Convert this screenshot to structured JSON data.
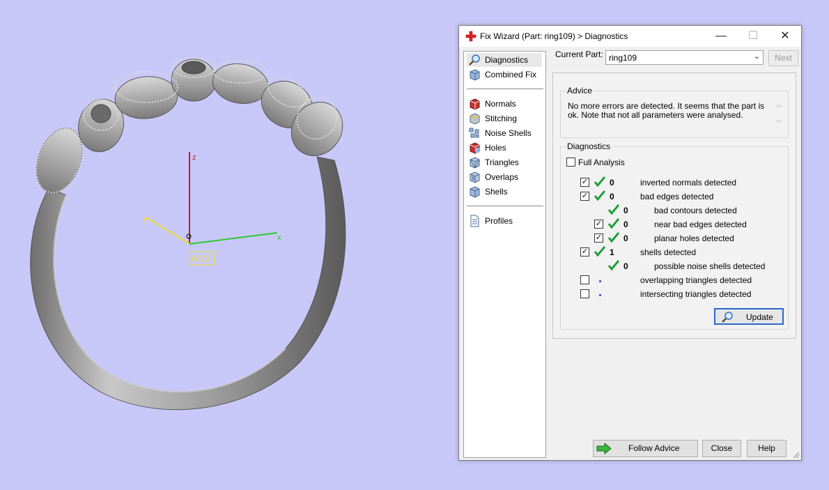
{
  "viewport": {
    "background": "#c8c8f8",
    "axes": {
      "z_label": "z",
      "x_label": "x",
      "y_label": "y",
      "wcs_label": "WCS"
    },
    "model": "ring"
  },
  "dialog": {
    "title": "Fix Wizard (Part: ring109) > Diagnostics",
    "window_buttons": {
      "minimize": "—",
      "maximize": "☐",
      "close": "✕"
    },
    "nav": {
      "items": [
        {
          "label": "Diagnostics",
          "icon": "magnifier-icon",
          "selected": true
        },
        {
          "label": "Combined Fix",
          "icon": "cube-icon"
        },
        {
          "label": "Normals",
          "icon": "normals-icon"
        },
        {
          "label": "Stitching",
          "icon": "stitching-icon"
        },
        {
          "label": "Noise Shells",
          "icon": "noise-shells-icon"
        },
        {
          "label": "Holes",
          "icon": "holes-icon"
        },
        {
          "label": "Triangles",
          "icon": "triangles-icon"
        },
        {
          "label": "Overlaps",
          "icon": "overlaps-icon"
        },
        {
          "label": "Shells",
          "icon": "shells-icon"
        },
        {
          "label": "Profiles",
          "icon": "document-icon"
        }
      ]
    },
    "current_part_label": "Current Part:",
    "current_part_value": "ring109",
    "next_label": "Next",
    "advice": {
      "title": "Advice",
      "text": "No more errors are detected. It seems that the part is ok. Note that not all parameters were analysed."
    },
    "diagnostics": {
      "title": "Diagnostics",
      "full_analysis_label": "Full Analysis",
      "rows": [
        {
          "count": "0",
          "label": "inverted normals detected"
        },
        {
          "count": "0",
          "label": "bad edges detected"
        },
        {
          "count": "0",
          "label": "bad contours detected"
        },
        {
          "count": "0",
          "label": "near bad edges detected"
        },
        {
          "count": "0",
          "label": "planar holes detected"
        },
        {
          "count": "1",
          "label": "shells detected"
        },
        {
          "count": "0",
          "label": "possible noise shells detected"
        },
        {
          "count": "",
          "label": "overlapping triangles detected"
        },
        {
          "count": "",
          "label": "intersecting triangles detected"
        }
      ],
      "update_label": "Update"
    },
    "buttons": {
      "follow_advice": "Follow Advice",
      "close": "Close",
      "help": "Help"
    },
    "colors": {
      "check_green": "#1e9e3a",
      "accent_blue": "#2a68c8",
      "red_cross": "#e02020"
    }
  }
}
